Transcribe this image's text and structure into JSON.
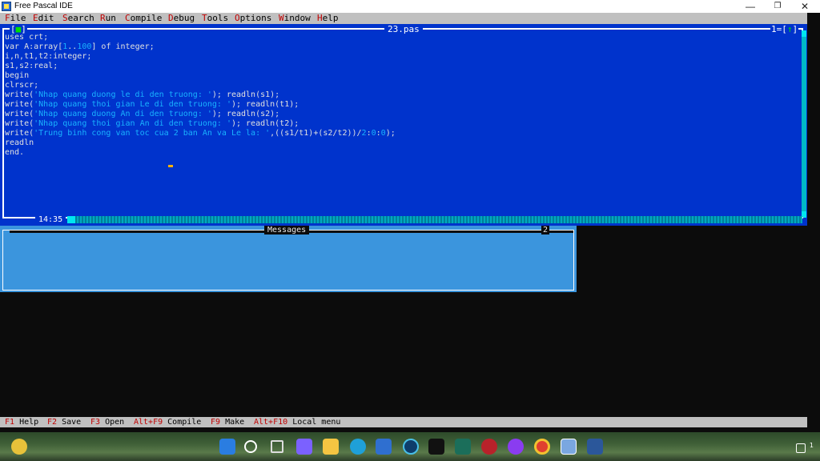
{
  "window": {
    "title": "Free Pascal IDE",
    "min_glyph": "—",
    "max_glyph": "❐",
    "close_glyph": "✕"
  },
  "menu": {
    "items": [
      {
        "hotkey": "F",
        "rest": "ile"
      },
      {
        "hotkey": "E",
        "rest": "dit"
      },
      {
        "hotkey": "S",
        "rest": "earch"
      },
      {
        "hotkey": "R",
        "rest": "un"
      },
      {
        "hotkey": "C",
        "rest": "ompile"
      },
      {
        "hotkey": "D",
        "rest": "ebug"
      },
      {
        "hotkey": "T",
        "rest": "ools"
      },
      {
        "hotkey": "O",
        "rest": "ptions"
      },
      {
        "hotkey": "W",
        "rest": "indow"
      },
      {
        "hotkey": "H",
        "rest": "elp"
      }
    ]
  },
  "editor": {
    "close_glyph": "■",
    "file_name": "23.pas",
    "window_number": "1",
    "zoom_glyph": "↑",
    "cursor_position": "14:35",
    "lines": [
      "uses crt;",
      "var A:array[1..100] of integer;",
      "i,n,t1,t2:integer;",
      "s1,s2:real;",
      "begin",
      "clrscr;",
      "write('Nhap quang duong le di den truong: '); readln(s1);",
      "write('Nhap quang thoi gian Le di den truong: '); readln(t1);",
      "write('Nhap quang duong An di den truong: '); readln(s2);",
      "write('Nhap quang thoi gian An di den truong: '); readln(t2);",
      "write('Trung binh cong van toc cua 2 ban An va Le la: ',((s1/t1)+(s2/t2))/2:0:0);",
      "readln",
      "end."
    ]
  },
  "messages": {
    "title": "Messages",
    "window_number": "2"
  },
  "status": {
    "items": [
      {
        "key": "F1",
        "label": "Help"
      },
      {
        "key": "F2",
        "label": "Save"
      },
      {
        "key": "F3",
        "label": "Open"
      },
      {
        "key": "Alt+F9",
        "label": "Compile"
      },
      {
        "key": "F9",
        "label": "Make"
      },
      {
        "key": "Alt+F10",
        "label": "Local menu"
      }
    ]
  },
  "colors": {
    "editor_bg": "#0033cc",
    "messages_bg": "#3b95dd",
    "hotkey": "#c00000",
    "literal": "#19b3ff"
  },
  "taskbar": {
    "icons": [
      "start-icon",
      "search-icon",
      "task-view-icon",
      "chat-icon",
      "file-explorer-icon",
      "edge-icon",
      "store-icon",
      "app-icon",
      "tiktok-icon",
      "app-icon-2",
      "app-icon-3",
      "messenger-icon",
      "chrome-icon",
      "free-pascal-icon",
      "word-icon"
    ],
    "tray_badge": "1"
  }
}
